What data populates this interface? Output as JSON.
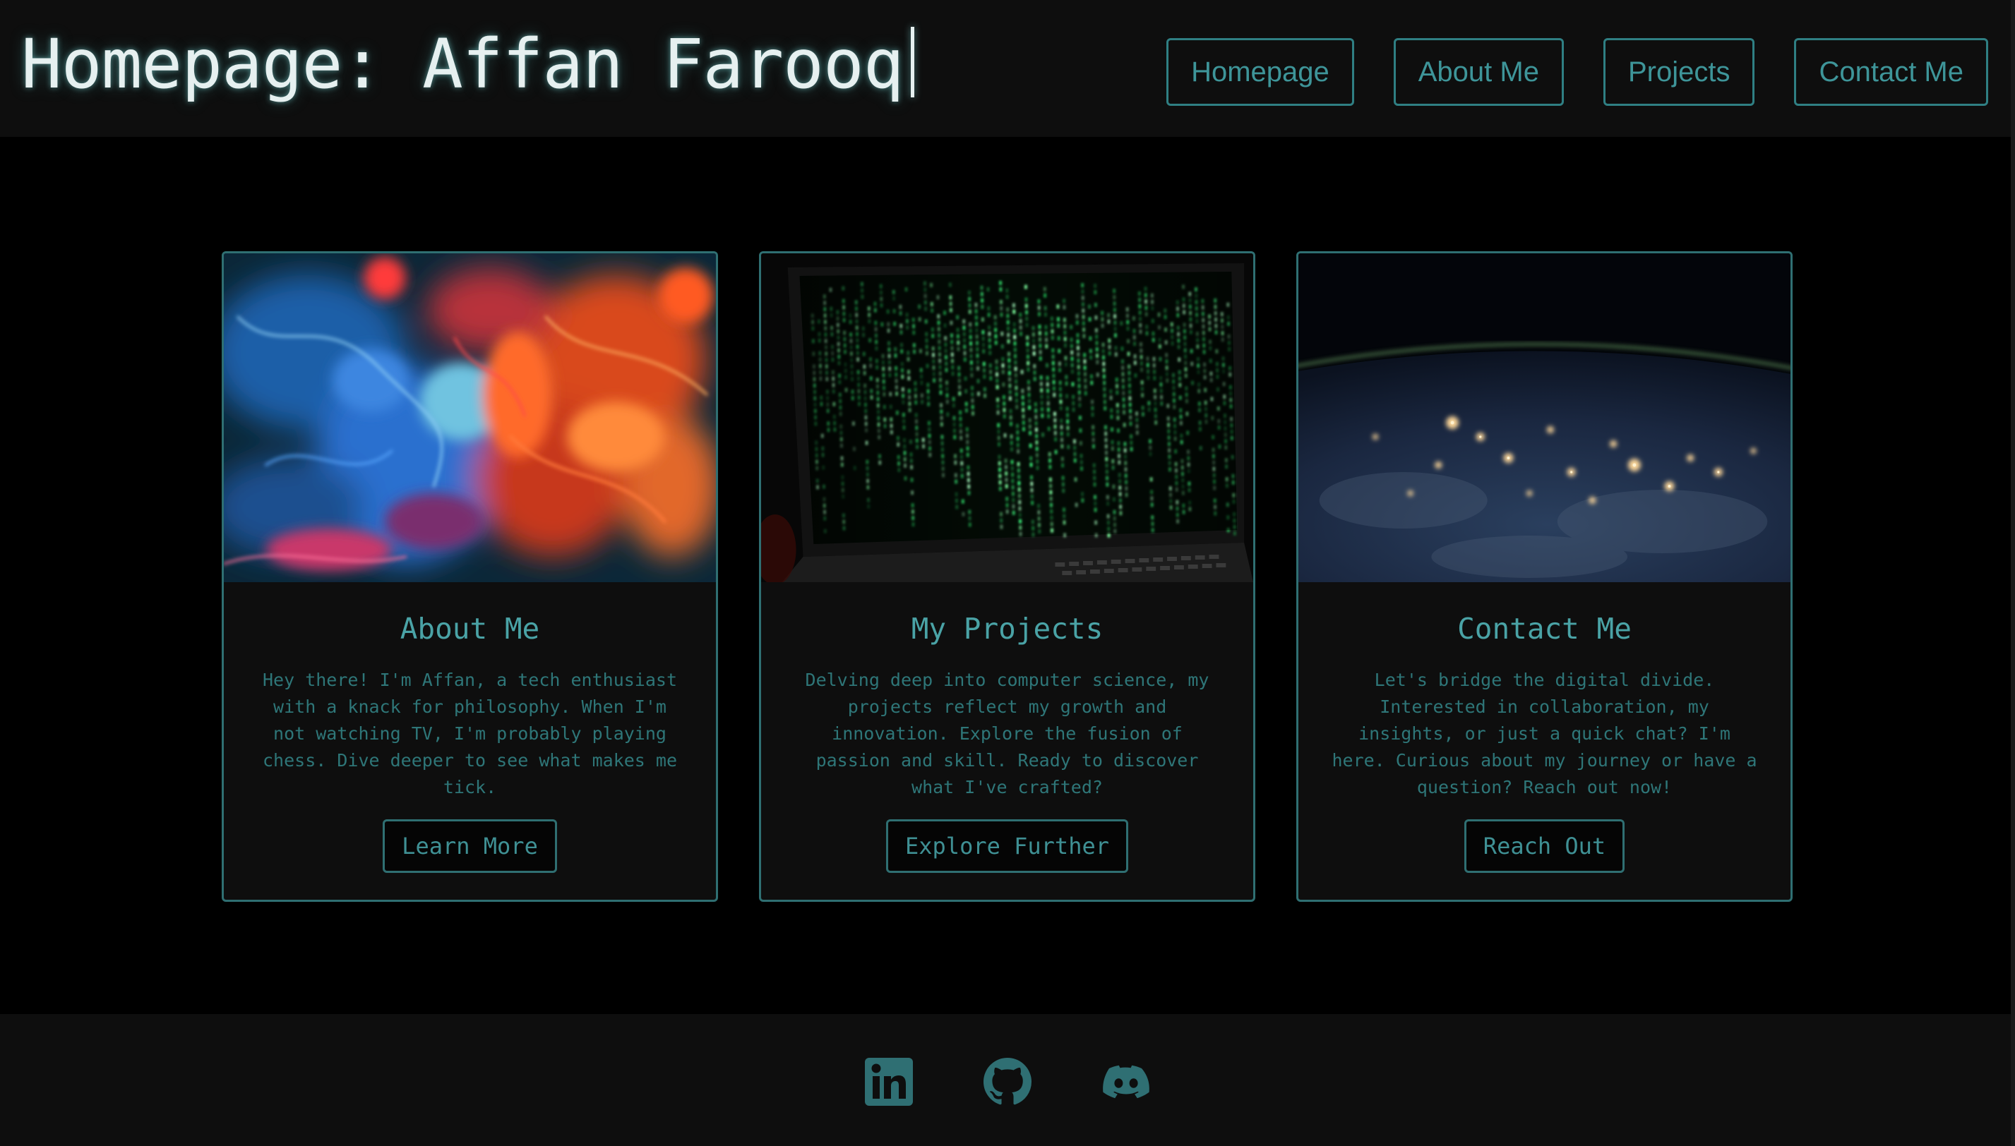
{
  "header": {
    "title": "Homepage: Affan Farooq",
    "nav": [
      {
        "label": "Homepage"
      },
      {
        "label": "About Me"
      },
      {
        "label": "Projects"
      },
      {
        "label": "Contact Me"
      }
    ]
  },
  "cards": [
    {
      "image": "colorful-ink-smoke-image",
      "title": "About Me",
      "text": "Hey there! I'm Affan, a tech enthusiast with a knack for philosophy. When I'm not watching TV, I'm probably playing chess. Dive deeper to see what makes me tick.",
      "button": "Learn More"
    },
    {
      "image": "matrix-code-laptop-image",
      "title": "My Projects",
      "text": "Delving deep into computer science, my projects reflect my growth and innovation. Explore the fusion of passion and skill. Ready to discover what I've crafted?",
      "button": "Explore Further"
    },
    {
      "image": "earth-at-night-image",
      "title": "Contact Me",
      "text": "Let's bridge the digital divide. Interested in collaboration, my insights, or just a quick chat? I'm here. Curious about my journey or have a question? Reach out now!",
      "button": "Reach Out"
    }
  ],
  "footer": {
    "icons": [
      "linkedin-icon",
      "github-icon",
      "discord-icon"
    ]
  },
  "colors": {
    "background": "#000000",
    "panel": "#0e0e0e",
    "accent": "#3e9599",
    "border": "#2f7f83",
    "title_text": "#e6f0f0"
  }
}
